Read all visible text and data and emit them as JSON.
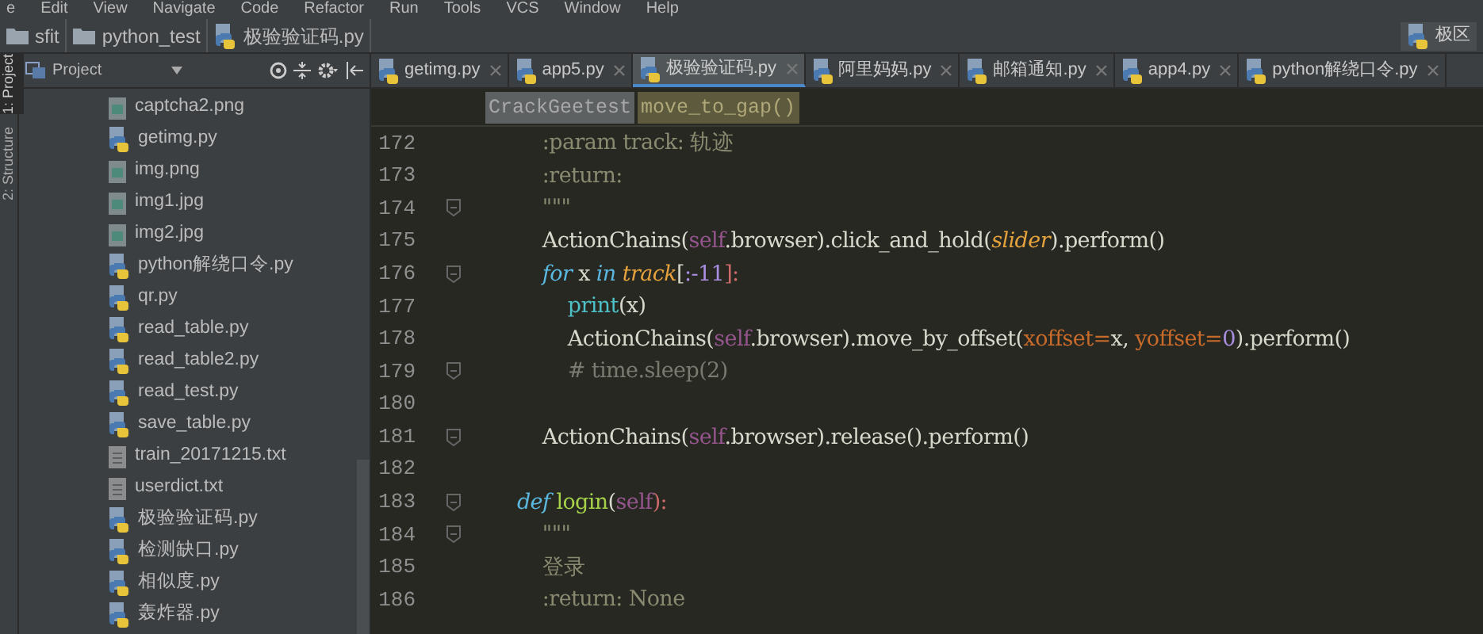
{
  "menu_bar": [
    "e",
    "Edit",
    "View",
    "Navigate",
    "Code",
    "Refactor",
    "Run",
    "Tools",
    "VCS",
    "Window",
    "Help"
  ],
  "breadcrumbs": [
    {
      "label": "sfit",
      "kind": "folder"
    },
    {
      "label": "python_test",
      "kind": "folder"
    },
    {
      "label": "极验验证码.py",
      "kind": "python"
    }
  ],
  "run_config": {
    "label": "极区"
  },
  "side_strip": [
    "1: Project",
    "2: Structure"
  ],
  "project_panel": {
    "title": "Project",
    "files": [
      {
        "name": "captcha2.png",
        "kind": "image"
      },
      {
        "name": "getimg.py",
        "kind": "python"
      },
      {
        "name": "img.png",
        "kind": "image"
      },
      {
        "name": "img1.jpg",
        "kind": "image"
      },
      {
        "name": "img2.jpg",
        "kind": "image"
      },
      {
        "name": "python解绕口令.py",
        "kind": "python"
      },
      {
        "name": "qr.py",
        "kind": "python"
      },
      {
        "name": "read_table.py",
        "kind": "python"
      },
      {
        "name": "read_table2.py",
        "kind": "python"
      },
      {
        "name": "read_test.py",
        "kind": "python"
      },
      {
        "name": "save_table.py",
        "kind": "python"
      },
      {
        "name": "train_20171215.txt",
        "kind": "text"
      },
      {
        "name": "userdict.txt",
        "kind": "text"
      },
      {
        "name": "极验验证码.py",
        "kind": "python"
      },
      {
        "name": "检测缺口.py",
        "kind": "python"
      },
      {
        "name": "相似度.py",
        "kind": "python"
      },
      {
        "name": "轰炸器.py",
        "kind": "python"
      }
    ]
  },
  "tabs": [
    {
      "label": "getimg.py",
      "selected": false
    },
    {
      "label": "app5.py",
      "selected": false
    },
    {
      "label": "极验验证码.py",
      "selected": true
    },
    {
      "label": "阿里妈妈.py",
      "selected": false
    },
    {
      "label": "邮箱通知.py",
      "selected": false
    },
    {
      "label": "app4.py",
      "selected": false
    },
    {
      "label": "python解绕口令.py",
      "selected": false
    }
  ],
  "editor_breadcrumbs": [
    {
      "label": "CrackGeetest",
      "kind": "class"
    },
    {
      "label": "move_to_gap()",
      "kind": "method"
    }
  ],
  "code_lines": [
    {
      "number": "172",
      "fold": false,
      "tokens": [
        {
          "t": "        :param track: 轨迹",
          "kind": "doc"
        }
      ]
    },
    {
      "number": "173",
      "fold": false,
      "tokens": [
        {
          "t": "        :return:",
          "kind": "doc"
        }
      ]
    },
    {
      "number": "174",
      "fold": true,
      "tokens": [
        {
          "t": "        \"\"\"",
          "kind": "doc"
        }
      ]
    },
    {
      "number": "175",
      "fold": false,
      "tokens": [
        {
          "t": "        ActionChains(",
          "kind": "plain"
        },
        {
          "t": "self",
          "kind": "self"
        },
        {
          "t": ".browser).click_and_hold(",
          "kind": "plain"
        },
        {
          "t": "slider",
          "kind": "param"
        },
        {
          "t": ").perform()",
          "kind": "plain"
        }
      ]
    },
    {
      "number": "176",
      "fold": true,
      "tokens": [
        {
          "t": "        for",
          "kind": "keyword"
        },
        {
          "t": " x ",
          "kind": "plain"
        },
        {
          "t": "in",
          "kind": "keyword"
        },
        {
          "t": " track",
          "kind": "param"
        },
        {
          "t": "[",
          "kind": "plain"
        },
        {
          "t": ":-11",
          "kind": "number"
        },
        {
          "t": "]:",
          "kind": "punct"
        }
      ]
    },
    {
      "number": "177",
      "fold": false,
      "tokens": [
        {
          "t": "            print",
          "kind": "builtin"
        },
        {
          "t": "(x)",
          "kind": "plain"
        }
      ]
    },
    {
      "number": "178",
      "fold": false,
      "tokens": [
        {
          "t": "            ActionChains(",
          "kind": "plain"
        },
        {
          "t": "self",
          "kind": "self"
        },
        {
          "t": ".browser).move_by_offset(",
          "kind": "plain"
        },
        {
          "t": "xoffset=",
          "kind": "kwarg"
        },
        {
          "t": "x, ",
          "kind": "plain"
        },
        {
          "t": "yoffset=",
          "kind": "kwarg"
        },
        {
          "t": "0",
          "kind": "number"
        },
        {
          "t": ").perform()",
          "kind": "plain"
        }
      ]
    },
    {
      "number": "179",
      "fold": true,
      "tokens": [
        {
          "t": "            # time.sleep(2)",
          "kind": "comment"
        }
      ]
    },
    {
      "number": "180",
      "fold": false
    },
    {
      "number": "181",
      "fold": true,
      "tokens": [
        {
          "t": "        ActionChains(",
          "kind": "plain"
        },
        {
          "t": "self",
          "kind": "self"
        },
        {
          "t": ".browser).release().perform()",
          "kind": "plain"
        }
      ]
    },
    {
      "number": "182",
      "fold": false
    },
    {
      "number": "183",
      "fold": true,
      "tokens": [
        {
          "t": "    def",
          "kind": "keyword"
        },
        {
          "t": " login",
          "kind": "func"
        },
        {
          "t": "(",
          "kind": "plain"
        },
        {
          "t": "self",
          "kind": "self"
        },
        {
          "t": "):",
          "kind": "punct"
        }
      ]
    },
    {
      "number": "184",
      "fold": true,
      "tokens": [
        {
          "t": "        \"\"\"",
          "kind": "doc"
        }
      ]
    },
    {
      "number": "185",
      "fold": false,
      "tokens": [
        {
          "t": "        登录",
          "kind": "doc"
        }
      ]
    },
    {
      "number": "186",
      "fold": false,
      "tokens": [
        {
          "t": "        :return: None",
          "kind": "doc"
        }
      ]
    }
  ]
}
